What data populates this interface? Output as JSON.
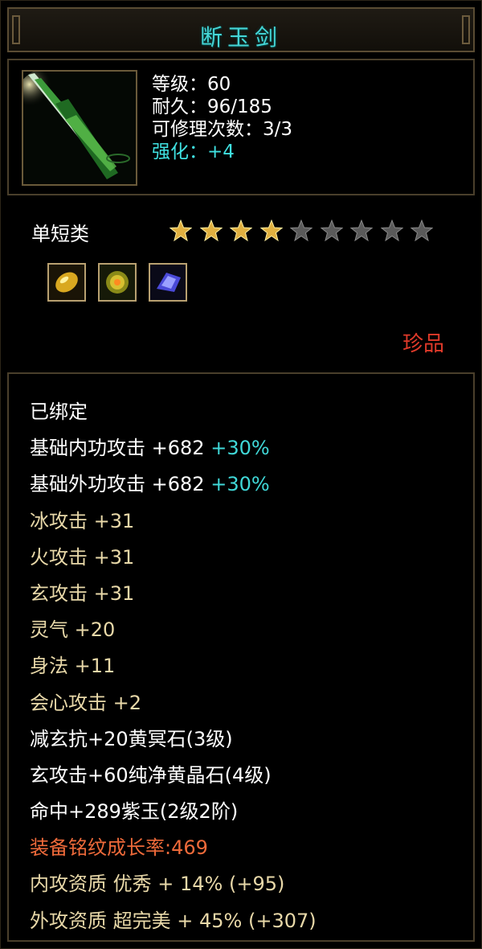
{
  "item": {
    "name": "断玉剑",
    "stats": {
      "level": "等级：60",
      "durability": "耐久：96/185",
      "repairs": "可修理次数：3/3",
      "enhance": "强化：+4"
    },
    "category": "单短类",
    "stars": {
      "filled": 4,
      "total": 9
    },
    "rarity": "珍品",
    "gems": [
      "gold-gem-icon",
      "yellow-crystal-gem-icon",
      "purple-jade-gem-icon"
    ]
  },
  "attributes": {
    "bound": "已绑定",
    "base_inner": {
      "label": "基础内功攻击",
      "value": "+682",
      "bonus": "+30%"
    },
    "base_outer": {
      "label": "基础外功攻击",
      "value": "+682",
      "bonus": "+30%"
    },
    "ice": {
      "label": "冰攻击",
      "value": "+31"
    },
    "fire": {
      "label": "火攻击",
      "value": "+31"
    },
    "xuan": {
      "label": "玄攻击",
      "value": "+31"
    },
    "spirit": {
      "label": "灵气",
      "value": "+20"
    },
    "agility": {
      "label": "身法",
      "value": "+11"
    },
    "crit": {
      "label": "会心攻击",
      "value": "+2"
    },
    "gem1": "减玄抗+20黄冥石(3级)",
    "gem2": "玄攻击+60纯净黄晶石(4级)",
    "gem3": "命中+289紫玉(2级2阶)",
    "growth": "装备铭纹成长率:469",
    "inner_quality": "内攻资质 优秀 + 14% (+95)",
    "outer_quality": "外攻资质 超完美 + 45% (+307)"
  },
  "colors": {
    "title": "#45d6d6",
    "attribute_gold": "#e8d8a8",
    "bonus_cyan": "#40d8d8",
    "rarity_red": "#e03a2a",
    "growth_orange": "#ee6a3a"
  }
}
